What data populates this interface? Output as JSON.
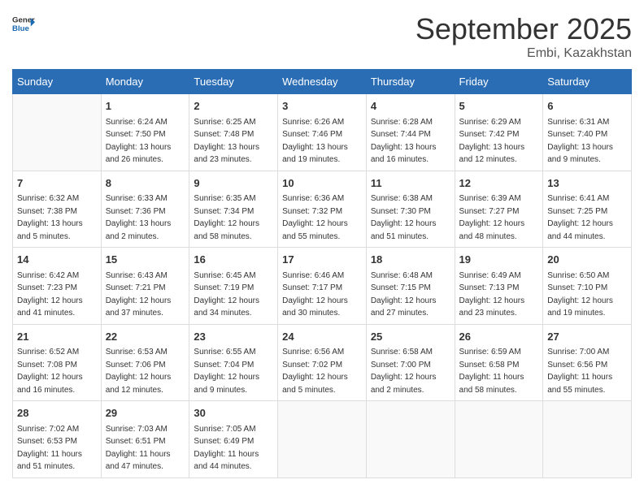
{
  "header": {
    "logo_general": "General",
    "logo_blue": "Blue",
    "month_title": "September 2025",
    "location": "Embi, Kazakhstan"
  },
  "days_of_week": [
    "Sunday",
    "Monday",
    "Tuesday",
    "Wednesday",
    "Thursday",
    "Friday",
    "Saturday"
  ],
  "weeks": [
    [
      {
        "day": "",
        "info": ""
      },
      {
        "day": "1",
        "info": "Sunrise: 6:24 AM\nSunset: 7:50 PM\nDaylight: 13 hours\nand 26 minutes."
      },
      {
        "day": "2",
        "info": "Sunrise: 6:25 AM\nSunset: 7:48 PM\nDaylight: 13 hours\nand 23 minutes."
      },
      {
        "day": "3",
        "info": "Sunrise: 6:26 AM\nSunset: 7:46 PM\nDaylight: 13 hours\nand 19 minutes."
      },
      {
        "day": "4",
        "info": "Sunrise: 6:28 AM\nSunset: 7:44 PM\nDaylight: 13 hours\nand 16 minutes."
      },
      {
        "day": "5",
        "info": "Sunrise: 6:29 AM\nSunset: 7:42 PM\nDaylight: 13 hours\nand 12 minutes."
      },
      {
        "day": "6",
        "info": "Sunrise: 6:31 AM\nSunset: 7:40 PM\nDaylight: 13 hours\nand 9 minutes."
      }
    ],
    [
      {
        "day": "7",
        "info": "Sunrise: 6:32 AM\nSunset: 7:38 PM\nDaylight: 13 hours\nand 5 minutes."
      },
      {
        "day": "8",
        "info": "Sunrise: 6:33 AM\nSunset: 7:36 PM\nDaylight: 13 hours\nand 2 minutes."
      },
      {
        "day": "9",
        "info": "Sunrise: 6:35 AM\nSunset: 7:34 PM\nDaylight: 12 hours\nand 58 minutes."
      },
      {
        "day": "10",
        "info": "Sunrise: 6:36 AM\nSunset: 7:32 PM\nDaylight: 12 hours\nand 55 minutes."
      },
      {
        "day": "11",
        "info": "Sunrise: 6:38 AM\nSunset: 7:30 PM\nDaylight: 12 hours\nand 51 minutes."
      },
      {
        "day": "12",
        "info": "Sunrise: 6:39 AM\nSunset: 7:27 PM\nDaylight: 12 hours\nand 48 minutes."
      },
      {
        "day": "13",
        "info": "Sunrise: 6:41 AM\nSunset: 7:25 PM\nDaylight: 12 hours\nand 44 minutes."
      }
    ],
    [
      {
        "day": "14",
        "info": "Sunrise: 6:42 AM\nSunset: 7:23 PM\nDaylight: 12 hours\nand 41 minutes."
      },
      {
        "day": "15",
        "info": "Sunrise: 6:43 AM\nSunset: 7:21 PM\nDaylight: 12 hours\nand 37 minutes."
      },
      {
        "day": "16",
        "info": "Sunrise: 6:45 AM\nSunset: 7:19 PM\nDaylight: 12 hours\nand 34 minutes."
      },
      {
        "day": "17",
        "info": "Sunrise: 6:46 AM\nSunset: 7:17 PM\nDaylight: 12 hours\nand 30 minutes."
      },
      {
        "day": "18",
        "info": "Sunrise: 6:48 AM\nSunset: 7:15 PM\nDaylight: 12 hours\nand 27 minutes."
      },
      {
        "day": "19",
        "info": "Sunrise: 6:49 AM\nSunset: 7:13 PM\nDaylight: 12 hours\nand 23 minutes."
      },
      {
        "day": "20",
        "info": "Sunrise: 6:50 AM\nSunset: 7:10 PM\nDaylight: 12 hours\nand 19 minutes."
      }
    ],
    [
      {
        "day": "21",
        "info": "Sunrise: 6:52 AM\nSunset: 7:08 PM\nDaylight: 12 hours\nand 16 minutes."
      },
      {
        "day": "22",
        "info": "Sunrise: 6:53 AM\nSunset: 7:06 PM\nDaylight: 12 hours\nand 12 minutes."
      },
      {
        "day": "23",
        "info": "Sunrise: 6:55 AM\nSunset: 7:04 PM\nDaylight: 12 hours\nand 9 minutes."
      },
      {
        "day": "24",
        "info": "Sunrise: 6:56 AM\nSunset: 7:02 PM\nDaylight: 12 hours\nand 5 minutes."
      },
      {
        "day": "25",
        "info": "Sunrise: 6:58 AM\nSunset: 7:00 PM\nDaylight: 12 hours\nand 2 minutes."
      },
      {
        "day": "26",
        "info": "Sunrise: 6:59 AM\nSunset: 6:58 PM\nDaylight: 11 hours\nand 58 minutes."
      },
      {
        "day": "27",
        "info": "Sunrise: 7:00 AM\nSunset: 6:56 PM\nDaylight: 11 hours\nand 55 minutes."
      }
    ],
    [
      {
        "day": "28",
        "info": "Sunrise: 7:02 AM\nSunset: 6:53 PM\nDaylight: 11 hours\nand 51 minutes."
      },
      {
        "day": "29",
        "info": "Sunrise: 7:03 AM\nSunset: 6:51 PM\nDaylight: 11 hours\nand 47 minutes."
      },
      {
        "day": "30",
        "info": "Sunrise: 7:05 AM\nSunset: 6:49 PM\nDaylight: 11 hours\nand 44 minutes."
      },
      {
        "day": "",
        "info": ""
      },
      {
        "day": "",
        "info": ""
      },
      {
        "day": "",
        "info": ""
      },
      {
        "day": "",
        "info": ""
      }
    ]
  ]
}
